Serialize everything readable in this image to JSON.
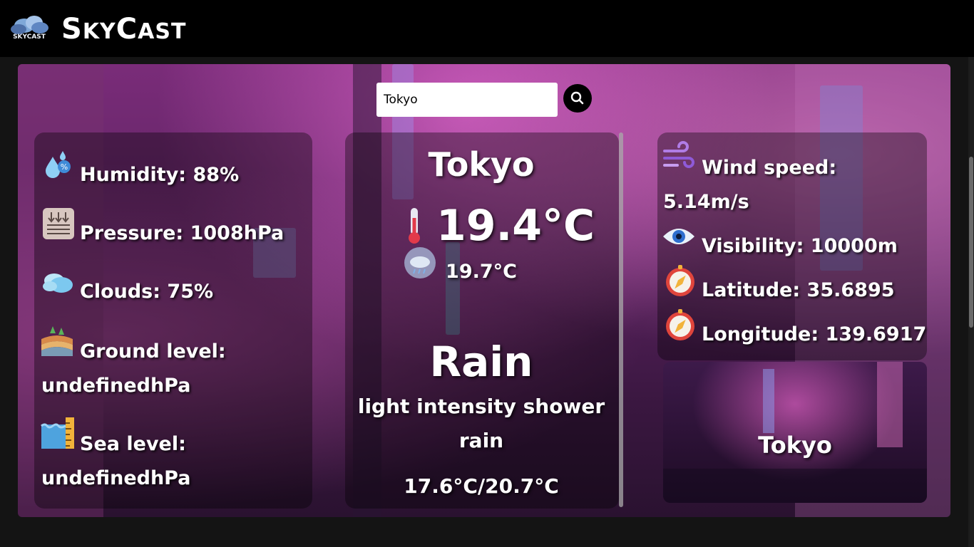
{
  "app": {
    "brand_big_1": "S",
    "brand_small_1": "KY",
    "brand_big_2": "C",
    "brand_small_2": "AST",
    "logo_text": "SKYCAST"
  },
  "search": {
    "value": "Tokyo",
    "button_icon": "search-icon"
  },
  "left_stats": [
    {
      "icon": "humidity-icon",
      "text": "Humidity: 88%"
    },
    {
      "icon": "pressure-icon",
      "text": "Pressure: 1008hPa"
    },
    {
      "icon": "clouds-icon",
      "text": "Clouds: 75%"
    },
    {
      "icon": "ground-level-icon",
      "line1": "Ground level:",
      "line2": "undefinedhPa"
    },
    {
      "icon": "sea-level-icon",
      "line1": "Sea level:",
      "line2": "undefinedhPa"
    }
  ],
  "center": {
    "city": "Tokyo",
    "temp": "19.4°C",
    "feels_like": "19.7°C",
    "condition": "Rain",
    "description_line1": "light intensity shower",
    "description_line2": "rain",
    "min_max": "17.6°C/20.7°C"
  },
  "right_stats": [
    {
      "icon": "wind-icon",
      "line1": "Wind speed:",
      "line2": "5.14m/s"
    },
    {
      "icon": "eye-icon",
      "text": "Visibility: 10000m"
    },
    {
      "icon": "compass-icon",
      "text": "Latitude: 35.6895"
    },
    {
      "icon": "compass-icon",
      "text": "Longitude: 139.6917"
    }
  ],
  "city_card": {
    "label": "Tokyo"
  },
  "colors": {
    "accent": "#e060c0",
    "background": "#141414",
    "topbar": "#000000"
  }
}
